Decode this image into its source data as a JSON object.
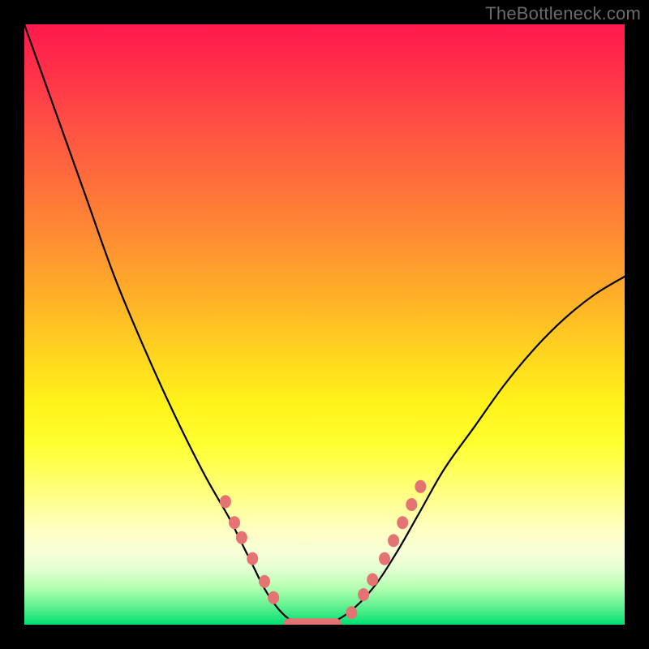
{
  "watermark": "TheBottleneck.com",
  "chart_data": {
    "type": "line",
    "title": "",
    "xlabel": "",
    "ylabel": "",
    "xlim": [
      0,
      1
    ],
    "ylim": [
      0,
      1
    ],
    "series": [
      {
        "name": "bottleneck-curve",
        "x": [
          0.0,
          0.05,
          0.1,
          0.15,
          0.2,
          0.25,
          0.3,
          0.34,
          0.36,
          0.38,
          0.4,
          0.42,
          0.44,
          0.46,
          0.5,
          0.54,
          0.58,
          0.62,
          0.66,
          0.7,
          0.75,
          0.8,
          0.85,
          0.9,
          0.95,
          1.0
        ],
        "y": [
          1.0,
          0.86,
          0.72,
          0.58,
          0.46,
          0.35,
          0.25,
          0.18,
          0.14,
          0.1,
          0.06,
          0.03,
          0.01,
          0.0,
          0.0,
          0.02,
          0.06,
          0.12,
          0.19,
          0.26,
          0.33,
          0.4,
          0.46,
          0.51,
          0.55,
          0.58
        ]
      }
    ],
    "markers": {
      "left_branch": [
        {
          "x": 0.335,
          "y": 0.205
        },
        {
          "x": 0.35,
          "y": 0.17
        },
        {
          "x": 0.362,
          "y": 0.145
        },
        {
          "x": 0.38,
          "y": 0.11
        },
        {
          "x": 0.4,
          "y": 0.072
        },
        {
          "x": 0.415,
          "y": 0.045
        }
      ],
      "valley_flat": [
        {
          "x": 0.44,
          "y": 0.008
        },
        {
          "x": 0.46,
          "y": 0.002
        },
        {
          "x": 0.49,
          "y": 0.0
        },
        {
          "x": 0.52,
          "y": 0.002
        }
      ],
      "right_branch": [
        {
          "x": 0.545,
          "y": 0.02
        },
        {
          "x": 0.565,
          "y": 0.05
        },
        {
          "x": 0.58,
          "y": 0.075
        },
        {
          "x": 0.6,
          "y": 0.11
        },
        {
          "x": 0.615,
          "y": 0.14
        },
        {
          "x": 0.63,
          "y": 0.17
        },
        {
          "x": 0.645,
          "y": 0.2
        },
        {
          "x": 0.66,
          "y": 0.23
        }
      ]
    },
    "colors": {
      "curve": "#000000",
      "markers": "#e57373",
      "gradient_top": "#ff1a4d",
      "gradient_bottom": "#00e070"
    }
  }
}
